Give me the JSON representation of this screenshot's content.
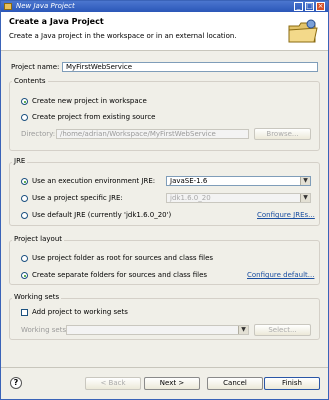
{
  "window": {
    "title": "New Java Project"
  },
  "header": {
    "title": "Create a Java Project",
    "description": "Create a Java project in the workspace or in an external location."
  },
  "project_name": {
    "label": "Project name:",
    "value": "MyFirstWebService"
  },
  "contents": {
    "title": "Contents",
    "new_label": "Create new project in workspace",
    "existing_label": "Create project from existing source",
    "dir_label": "Directory:",
    "dir_value": "/home/adrian/Workspace/MyFirstWebService",
    "browse_label": "Browse..."
  },
  "jre": {
    "title": "JRE",
    "exec_env_label": "Use an execution environment JRE:",
    "exec_env_value": "JavaSE-1.6",
    "specific_label": "Use a project specific JRE:",
    "specific_value": "jdk1.6.0_20",
    "default_label": "Use default JRE (currently 'jdk1.6.0_20')",
    "configure_link": "Configure JREs..."
  },
  "layout": {
    "title": "Project layout",
    "root_label": "Use project folder as root for sources and class files",
    "separate_label": "Create separate folders for sources and class files",
    "configure_link": "Configure default..."
  },
  "working_sets": {
    "title": "Working sets",
    "add_label": "Add project to working sets",
    "sets_label": "Working sets:",
    "select_label": "Select..."
  },
  "footer": {
    "back": "< Back",
    "next": "Next >",
    "cancel": "Cancel",
    "finish": "Finish",
    "help": "?"
  }
}
